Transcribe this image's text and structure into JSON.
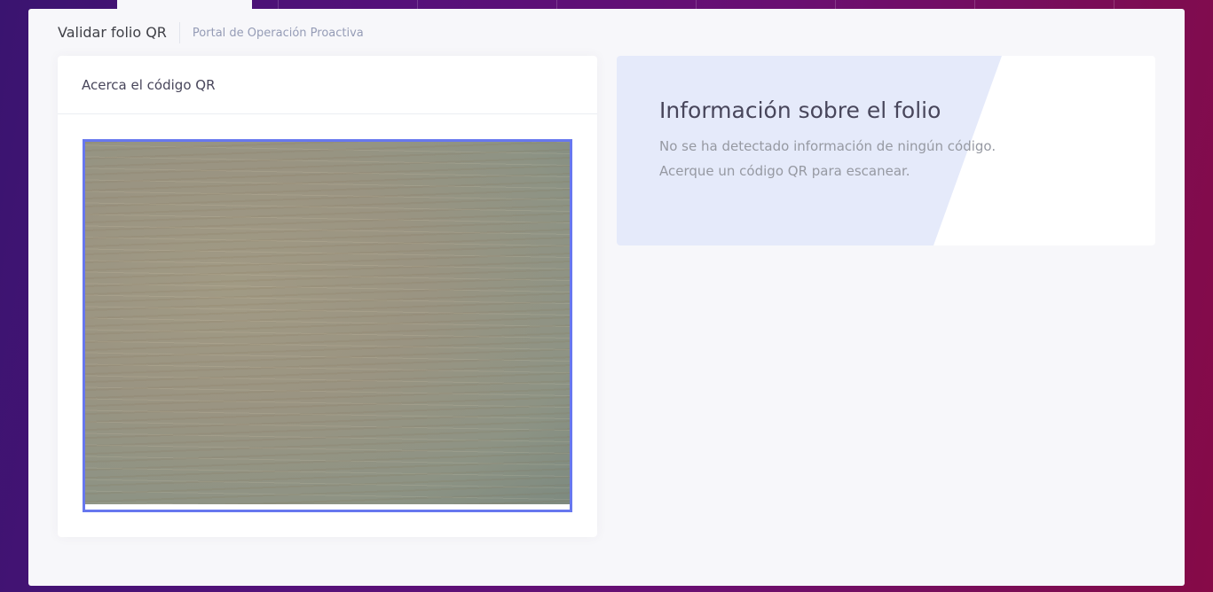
{
  "subheader": {
    "title": "Validar folio QR",
    "description": "Portal de Operación Proactiva"
  },
  "scanner": {
    "title": "Acerca el código QR"
  },
  "info": {
    "title": "Información sobre el folio",
    "line1": "No se ha detectado información de ningún código.",
    "line2": "Acerque un código QR para escanear."
  },
  "colors": {
    "accent": "#6777ef",
    "info_background": "#e5eafa"
  }
}
